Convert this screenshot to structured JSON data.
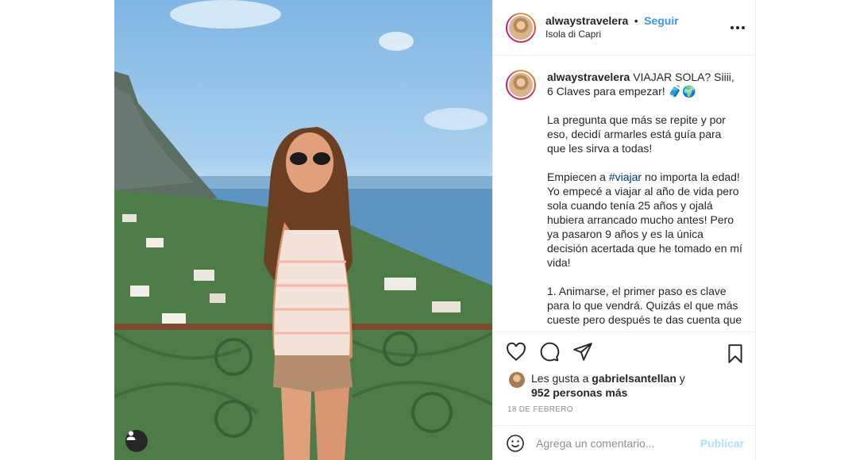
{
  "post": {
    "username": "alwaystravelera",
    "follow_label": "Seguir",
    "separator": "•",
    "location": "Isola di Capri",
    "caption_title": "VIAJAR SOLA? Siiii, 6 Claves para empezar! 🧳🌍",
    "caption_p1": "La pregunta que más se repite y por eso, decidí armarles está guía para que les sirva a todas!",
    "caption_p2_pre": "Empiecen a ",
    "caption_p2_tag": "#viajar",
    "caption_p2_post": " no importa la edad! Yo empecé a viajar al año de vida pero sola cuando tenía 25 años y ojalá hubiera arrancado mucho antes! Pero ya pasaron 9 años y es la única decisión acertada que he tomado en mí vida!",
    "caption_p3": "1. Animarse, el primer paso es clave para lo que vendrá. Quizás el que más cueste pero después te das cuenta que",
    "likes_prefix": "Les gusta a ",
    "likes_user": "gabrielsantellan",
    "likes_mid": " y",
    "likes_count": "952 personas más",
    "date": "18 DE FEBRERO"
  },
  "comment": {
    "placeholder": "Agrega un comentario...",
    "publish_label": "Publicar"
  },
  "icons": {
    "more": "more-horizontal-icon",
    "like": "heart-icon",
    "comment": "comment-bubble-icon",
    "share": "paper-plane-icon",
    "save": "bookmark-icon",
    "emoji": "emoji-icon",
    "tagged_user": "user-tag-icon"
  },
  "colors": {
    "accent": "#3897f0",
    "publish_disabled": "#b2dffc",
    "muted": "#8e8e8e",
    "border": "#efefef"
  }
}
